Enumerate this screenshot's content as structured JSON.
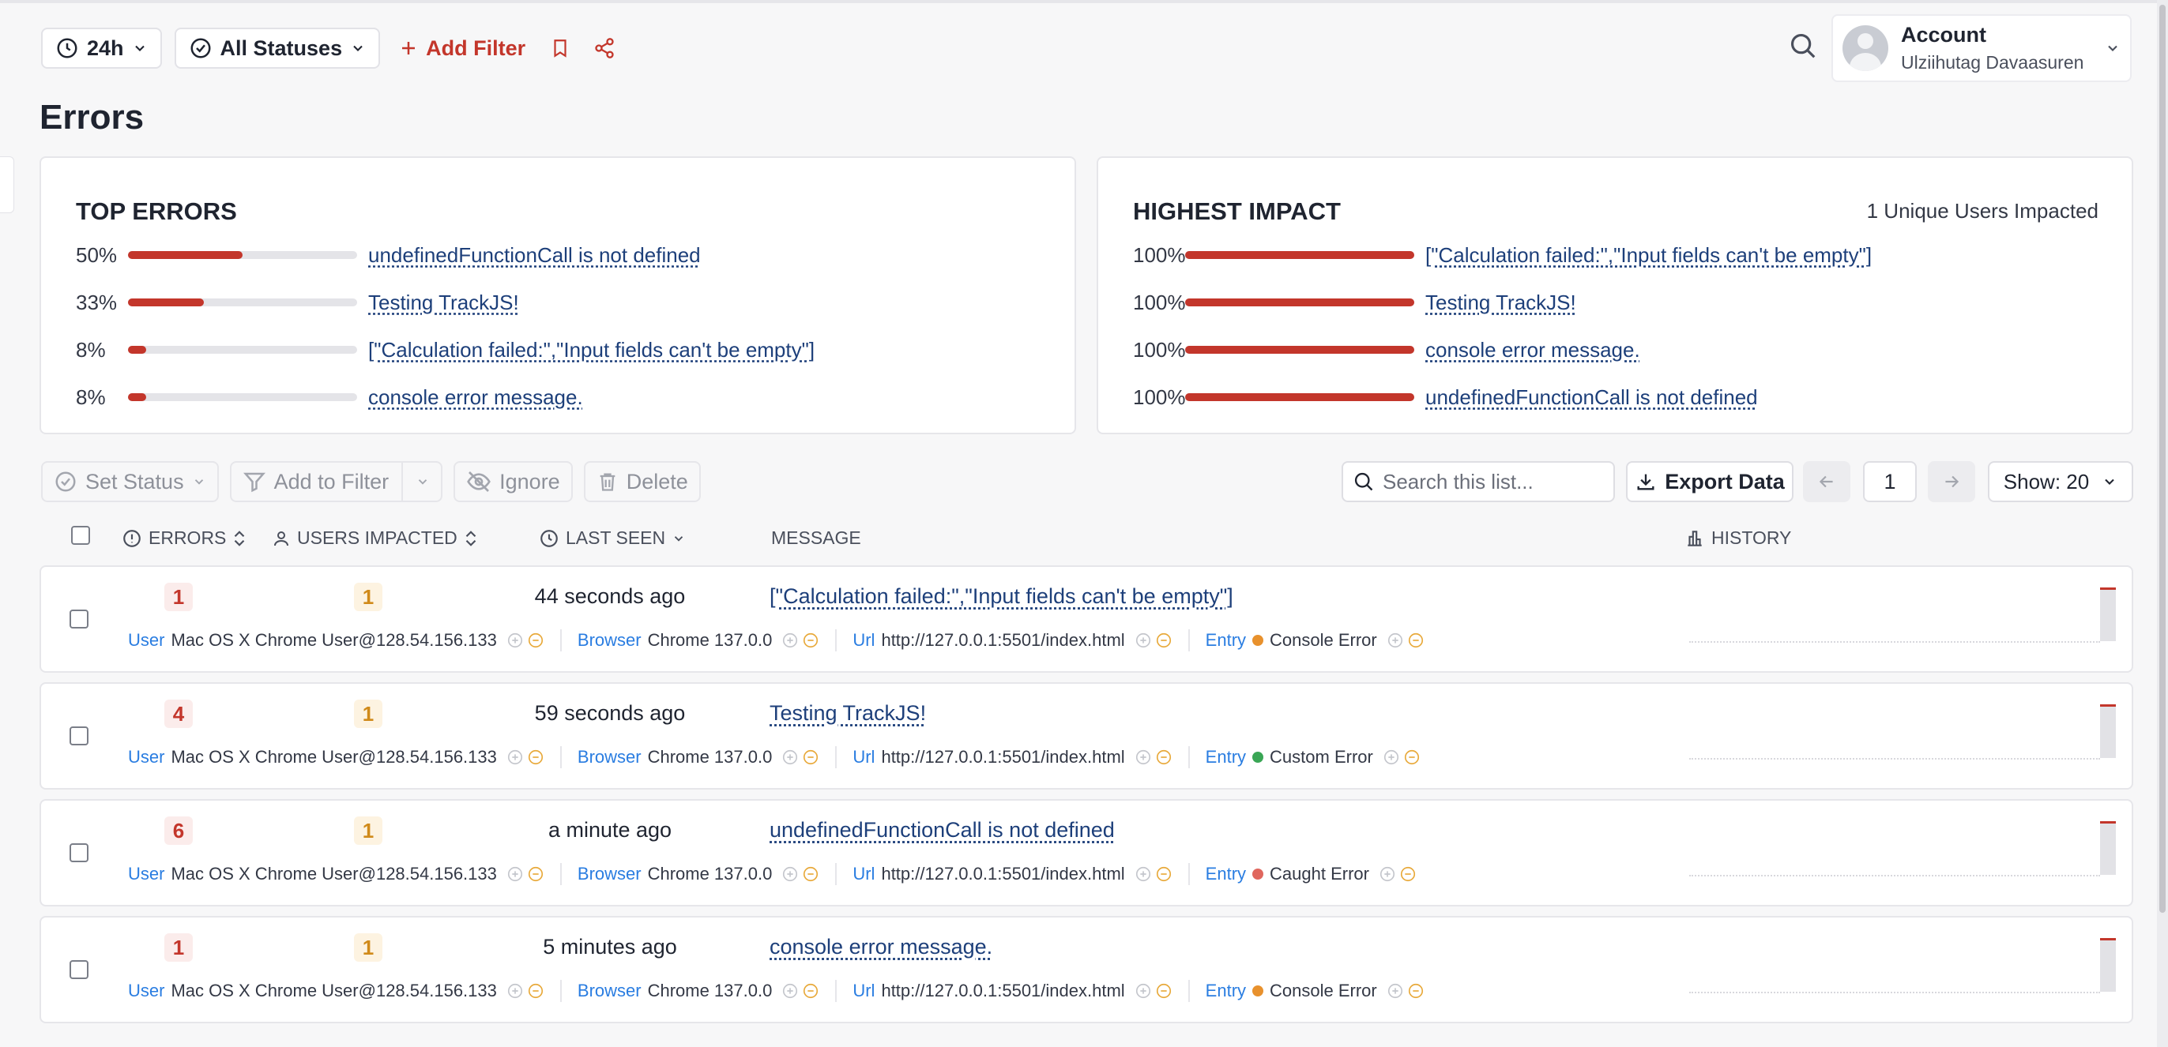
{
  "toolbar": {
    "time_range": "24h",
    "status_filter": "All Statuses",
    "add_filter_label": "Add Filter"
  },
  "account": {
    "title": "Account",
    "user_name": "Ulziihutag Davaasuren"
  },
  "page_title": "Errors",
  "top_errors": {
    "heading": "TOP ERRORS",
    "items": [
      {
        "percent": "50%",
        "fill": 0.5,
        "label": "undefinedFunctionCall is not defined"
      },
      {
        "percent": "33%",
        "fill": 0.33,
        "label": "Testing TrackJS!"
      },
      {
        "percent": "8%",
        "fill": 0.08,
        "label": "[\"Calculation failed:\",\"Input fields can't be empty\"]"
      },
      {
        "percent": "8%",
        "fill": 0.08,
        "label": "console error message."
      }
    ]
  },
  "highest_impact": {
    "heading": "HIGHEST IMPACT",
    "summary": "1 Unique Users Impacted",
    "items": [
      {
        "percent": "100%",
        "fill": 1.0,
        "label": "[\"Calculation failed:\",\"Input fields can't be empty\"]"
      },
      {
        "percent": "100%",
        "fill": 1.0,
        "label": "Testing TrackJS!"
      },
      {
        "percent": "100%",
        "fill": 1.0,
        "label": "console error message."
      },
      {
        "percent": "100%",
        "fill": 1.0,
        "label": "undefinedFunctionCall is not defined"
      }
    ]
  },
  "actions": {
    "set_status": "Set Status",
    "add_to_filter": "Add to Filter",
    "ignore": "Ignore",
    "delete": "Delete"
  },
  "list_controls": {
    "search_placeholder": "Search this list...",
    "export_label": "Export Data",
    "page_number": "1",
    "show_label": "Show: 20"
  },
  "table": {
    "headers": {
      "errors": "ERRORS",
      "users": "USERS IMPACTED",
      "last_seen": "LAST SEEN",
      "message": "MESSAGE",
      "history": "HISTORY"
    },
    "meta_keys": {
      "user": "User",
      "browser": "Browser",
      "url": "Url",
      "entry": "Entry"
    },
    "rows": [
      {
        "errors": "1",
        "users": "1",
        "last_seen": "44 seconds ago",
        "message": "[\"Calculation failed:\",\"Input fields can't be empty\"]",
        "user": "Mac OS X Chrome User@128.54.156.133",
        "browser": "Chrome 137.0.0",
        "url": "http://127.0.0.1:5501/index.html",
        "entry": "Console Error",
        "entry_color": "#e8912d"
      },
      {
        "errors": "4",
        "users": "1",
        "last_seen": "59 seconds ago",
        "message": "Testing TrackJS!",
        "user": "Mac OS X Chrome User@128.54.156.133",
        "browser": "Chrome 137.0.0",
        "url": "http://127.0.0.1:5501/index.html",
        "entry": "Custom Error",
        "entry_color": "#3aa655"
      },
      {
        "errors": "6",
        "users": "1",
        "last_seen": "a minute ago",
        "message": "undefinedFunctionCall is not defined",
        "user": "Mac OS X Chrome User@128.54.156.133",
        "browser": "Chrome 137.0.0",
        "url": "http://127.0.0.1:5501/index.html",
        "entry": "Caught Error",
        "entry_color": "#e0675e"
      },
      {
        "errors": "1",
        "users": "1",
        "last_seen": "5 minutes ago",
        "message": "console error message.",
        "user": "Mac OS X Chrome User@128.54.156.133",
        "browser": "Chrome 137.0.0",
        "url": "http://127.0.0.1:5501/index.html",
        "entry": "Console Error",
        "entry_color": "#e8912d"
      }
    ]
  },
  "colors": {
    "accent_red": "#c3362b",
    "link_blue": "#1d3f7a",
    "meta_key_blue": "#2a7de1",
    "user_badge_orange": "#d08a1a"
  }
}
